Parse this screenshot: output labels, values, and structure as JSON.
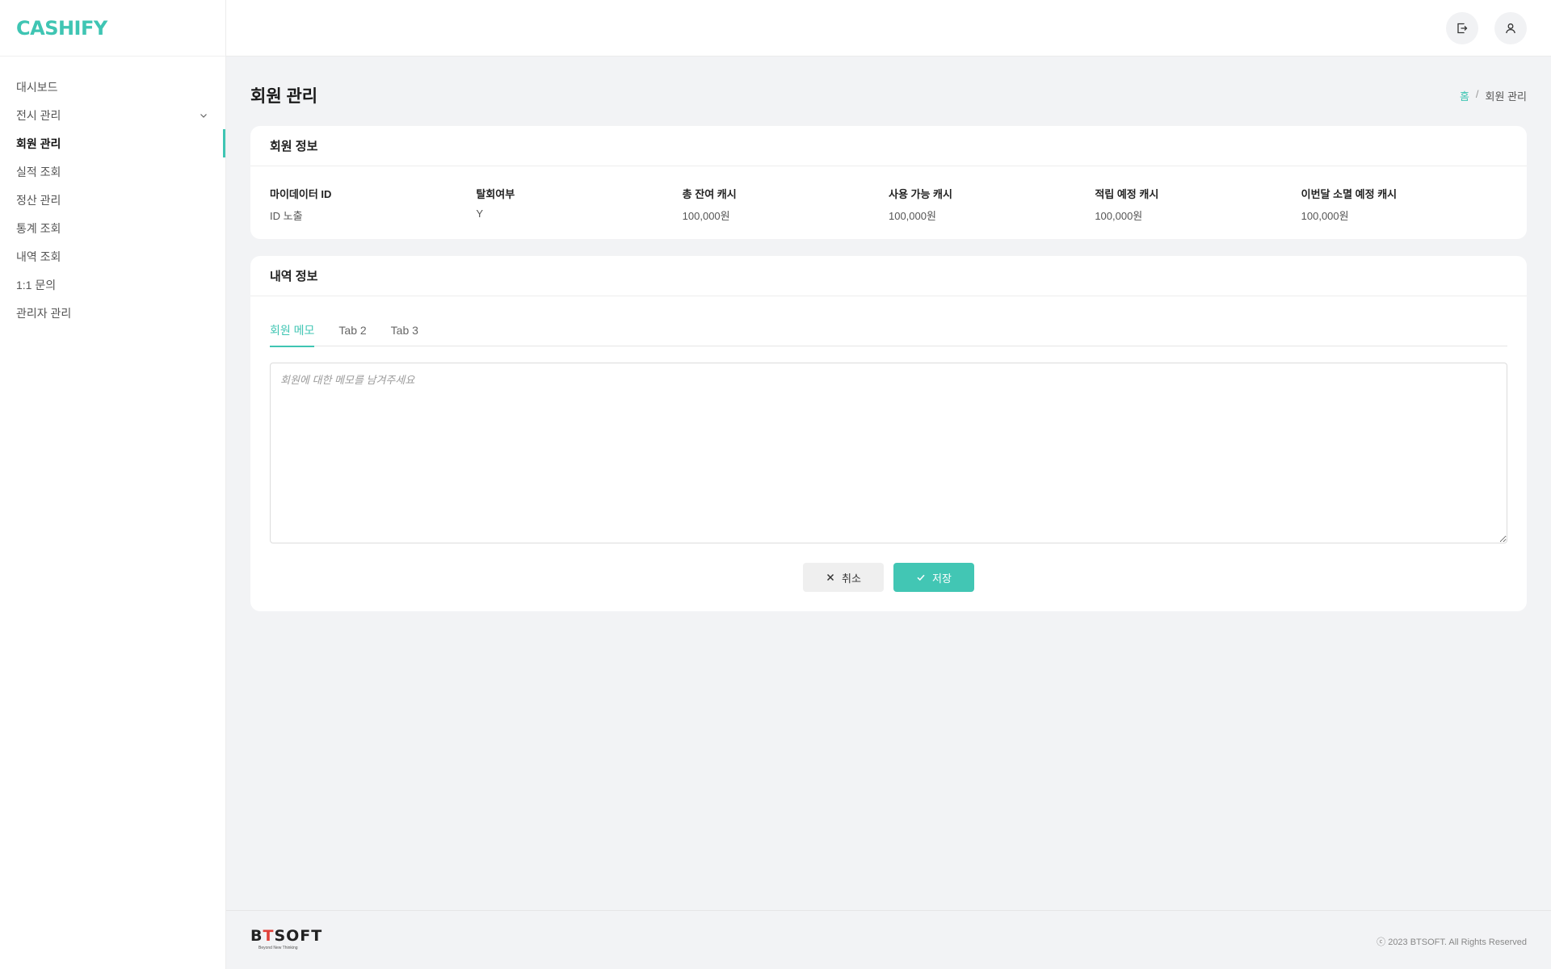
{
  "app": {
    "logo": "CASHIFY"
  },
  "sidebar": {
    "items": [
      {
        "label": "대시보드"
      },
      {
        "label": "전시 관리",
        "expandable": true
      },
      {
        "label": "회원 관리",
        "active": true
      },
      {
        "label": "실적 조회"
      },
      {
        "label": "정산 관리"
      },
      {
        "label": "통계 조회"
      },
      {
        "label": "내역 조회"
      },
      {
        "label": "1:1 문의"
      },
      {
        "label": "관리자 관리"
      }
    ]
  },
  "header": {
    "icons": [
      "logout-icon",
      "user-icon"
    ]
  },
  "page": {
    "title": "회원 관리",
    "breadcrumb": {
      "home": "홈",
      "separator": "/",
      "current": "회원 관리"
    }
  },
  "member_info": {
    "title": "회원 정보",
    "fields": [
      {
        "label": "마이데이터 ID",
        "value": "ID 노출"
      },
      {
        "label": "탈회여부",
        "value": "Y"
      },
      {
        "label": "총 잔여 캐시",
        "value": "100,000원"
      },
      {
        "label": "사용 가능 캐시",
        "value": "100,000원"
      },
      {
        "label": "적립 예정 캐시",
        "value": "100,000원"
      },
      {
        "label": "이번달 소멸 예정 캐시",
        "value": "100,000원"
      }
    ]
  },
  "history": {
    "title": "내역 정보",
    "tabs": [
      {
        "label": "회원 메모",
        "active": true
      },
      {
        "label": "Tab 2"
      },
      {
        "label": "Tab 3"
      }
    ],
    "memo": {
      "value": "",
      "placeholder": "회원에 대한 메모를 남겨주세요"
    },
    "cancel_label": "취소",
    "save_label": "저장"
  },
  "footer": {
    "brand_prefix": "B",
    "brand_t": "T",
    "brand_suffix": "SOFT",
    "brand_tagline": "Beyond New Thinking",
    "copyright": "ⓒ 2023 BTSOFT. All Rights Reserved"
  },
  "colors": {
    "accent": "#3fc5b3",
    "brand_red": "#e0413a"
  }
}
